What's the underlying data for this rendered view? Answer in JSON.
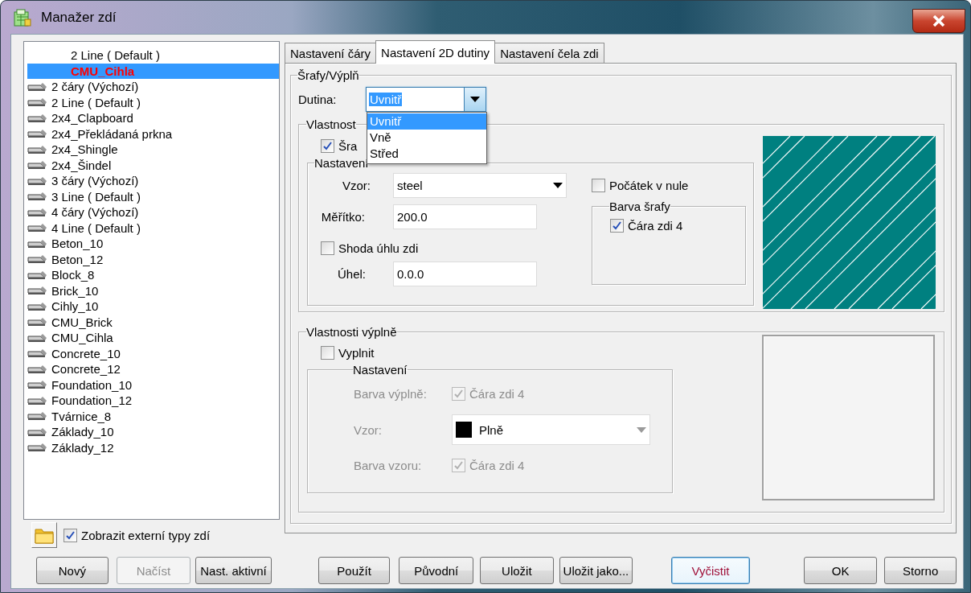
{
  "window": {
    "title": "Manažer zdí"
  },
  "wall_list": {
    "items": [
      {
        "label": "2 Line ( Default )",
        "kind": "default",
        "selected": false
      },
      {
        "label": "CMU_Cihla",
        "kind": "active",
        "selected": true
      },
      {
        "label": "2 čáry (Výchozí)",
        "kind": "wall",
        "selected": false
      },
      {
        "label": "2 Line ( Default )",
        "kind": "wall",
        "selected": false
      },
      {
        "label": "2x4_Clapboard",
        "kind": "wall",
        "selected": false
      },
      {
        "label": "2x4_Překládaná prkna",
        "kind": "wall",
        "selected": false
      },
      {
        "label": "2x4_Shingle",
        "kind": "wall",
        "selected": false
      },
      {
        "label": "2x4_Šindel",
        "kind": "wall",
        "selected": false
      },
      {
        "label": "3 čáry (Výchozí)",
        "kind": "wall",
        "selected": false
      },
      {
        "label": "3 Line ( Default )",
        "kind": "wall",
        "selected": false
      },
      {
        "label": "4 čáry (Výchozí)",
        "kind": "wall",
        "selected": false
      },
      {
        "label": "4 Line ( Default )",
        "kind": "wall",
        "selected": false
      },
      {
        "label": "Beton_10",
        "kind": "wall",
        "selected": false
      },
      {
        "label": "Beton_12",
        "kind": "wall",
        "selected": false
      },
      {
        "label": "Block_8",
        "kind": "wall",
        "selected": false
      },
      {
        "label": "Brick_10",
        "kind": "wall",
        "selected": false
      },
      {
        "label": "Cihly_10",
        "kind": "wall",
        "selected": false
      },
      {
        "label": "CMU_Brick",
        "kind": "wall",
        "selected": false
      },
      {
        "label": "CMU_Cihla",
        "kind": "wall",
        "selected": false
      },
      {
        "label": "Concrete_10",
        "kind": "wall",
        "selected": false
      },
      {
        "label": "Concrete_12",
        "kind": "wall",
        "selected": false
      },
      {
        "label": "Foundation_10",
        "kind": "wall",
        "selected": false
      },
      {
        "label": "Foundation_12",
        "kind": "wall",
        "selected": false
      },
      {
        "label": "Tvárnice_8",
        "kind": "wall",
        "selected": false
      },
      {
        "label": "Základy_10",
        "kind": "wall",
        "selected": false
      },
      {
        "label": "Základy_12",
        "kind": "wall",
        "selected": false
      }
    ]
  },
  "show_external": {
    "label": "Zobrazit externí typy zdí",
    "checked": true
  },
  "left_buttons": [
    {
      "label": "Nový",
      "disabled": false
    },
    {
      "label": "Načíst",
      "disabled": true
    },
    {
      "label": "Nast. aktivní",
      "disabled": false
    }
  ],
  "tabs": [
    {
      "label": "Nastavení čáry",
      "selected": false
    },
    {
      "label": "Nastavení 2D dutiny",
      "selected": true
    },
    {
      "label": "Nastavení čela zdi",
      "selected": false
    }
  ],
  "hatch_fill": {
    "title": "Šrafy/Výplň",
    "cavity": {
      "label": "Dutina:",
      "value": "Uvnitř",
      "expanded": true,
      "options": [
        {
          "label": "Uvnitř",
          "selected": true
        },
        {
          "label": "Vně",
          "selected": false
        },
        {
          "label": "Střed",
          "selected": false
        }
      ]
    },
    "hatch_properties": {
      "title": "Vlastnost",
      "hatch": {
        "label": "Šra",
        "checked": true
      },
      "settings": {
        "title": "Nastavení",
        "pattern": {
          "label": "Vzor:",
          "value": "steel"
        },
        "scale": {
          "label": "Měřítko:",
          "value": "200.0"
        },
        "match_angle": {
          "label": "Shoda úhlu zdi",
          "checked": false
        },
        "angle": {
          "label": "Úhel:",
          "value": "0.0.0"
        },
        "origin": {
          "label": "Počátek v nule",
          "checked": false
        },
        "hatch_color": {
          "title": "Barva šrafy",
          "label": "Čára zdi 4",
          "checked": true
        }
      }
    },
    "fill_properties": {
      "title": "Vlastnosti výplně",
      "fill": {
        "label": "Vyplnit",
        "checked": false
      },
      "settings": {
        "title": "Nastavení",
        "disabled": true,
        "fill_color": {
          "label": "Barva výplně:",
          "option": "Čára zdi 4",
          "checked": true
        },
        "pattern": {
          "label": "Vzor:",
          "value": "Plně"
        },
        "pattern_color": {
          "label": "Barva vzoru:",
          "option": "Čára zdi 4",
          "checked": true
        }
      }
    }
  },
  "action_buttons": [
    {
      "label": "Použít",
      "focused": false
    },
    {
      "label": "Původní",
      "focused": false
    },
    {
      "label": "Uložit",
      "focused": false
    },
    {
      "label": "Uložit jako...",
      "focused": false
    },
    {
      "label": "Vyčistit",
      "focused": true
    },
    {
      "label": "OK",
      "focused": false
    },
    {
      "label": "Storno",
      "focused": false
    }
  ]
}
